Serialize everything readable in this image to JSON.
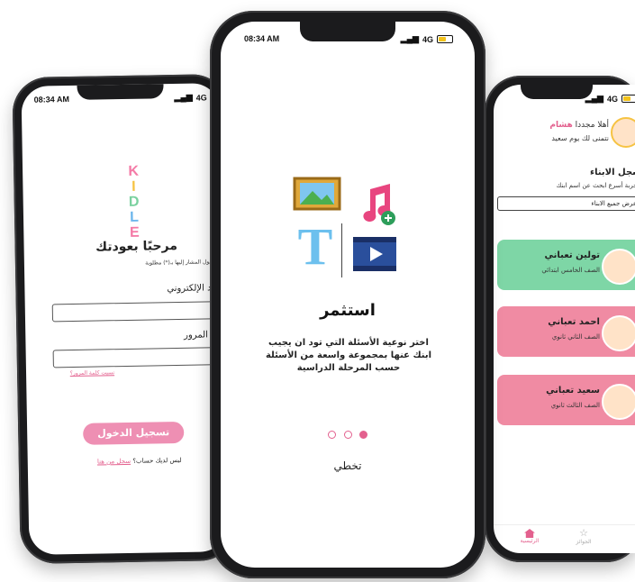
{
  "left_phone": {
    "status_time": "08:34 AM",
    "status_signal": "4G",
    "logo": "KIDLE",
    "title": "مرحبًا بعودتك",
    "note": "جميع الحقول المشار إليها بـ(*) مطلوبة",
    "email_label": "البريد الإلكتروني",
    "password_label": "كلمة المرور",
    "forgot_password": "نسيت كلمة المرور؟",
    "login_button": "تسجيل الدخول",
    "no_account_text": "ليس لديك حساب؟",
    "register_link": "سجل من هنا"
  },
  "center_phone": {
    "status_time": "08:34 AM",
    "status_signal": "4G",
    "title": "استثمر",
    "description": "اختر نوعية الأسئلة التي تود ان يجيب ابنك عنها بمجموعة واسعة من الأسئلة حسب المرحلة الدراسية",
    "skip": "تخطي",
    "page_indicator": {
      "total": 3,
      "active": 3
    }
  },
  "right_phone": {
    "status_signal": "4G",
    "greeting_prefix": "أهلا مجددا",
    "greeting_name": "هشام",
    "greeting_sub": "نتمنى لك يوم سعيد",
    "section_title": "سجل الابناء",
    "section_sub": "لتجربة أسرع ابحث عن اسم ابنك",
    "show_all": "عرض جميع الابناء",
    "children": [
      {
        "name": "تولين تعباني",
        "grade": "الصف الخامس ابتدائي",
        "color": "#7ed6a6"
      },
      {
        "name": "احمد تعباني",
        "grade": "الصف الثاني ثانوي",
        "color": "#f08ba3"
      },
      {
        "name": "سعيد تعباني",
        "grade": "الصف الثالث ثانوي",
        "color": "#f08ba3"
      }
    ],
    "nav": {
      "home": "الرئيسية",
      "awards": "الجوائز"
    }
  },
  "colors": {
    "pink": "#ee8fb3",
    "green": "#7ed6a6",
    "rose": "#f08ba3"
  }
}
